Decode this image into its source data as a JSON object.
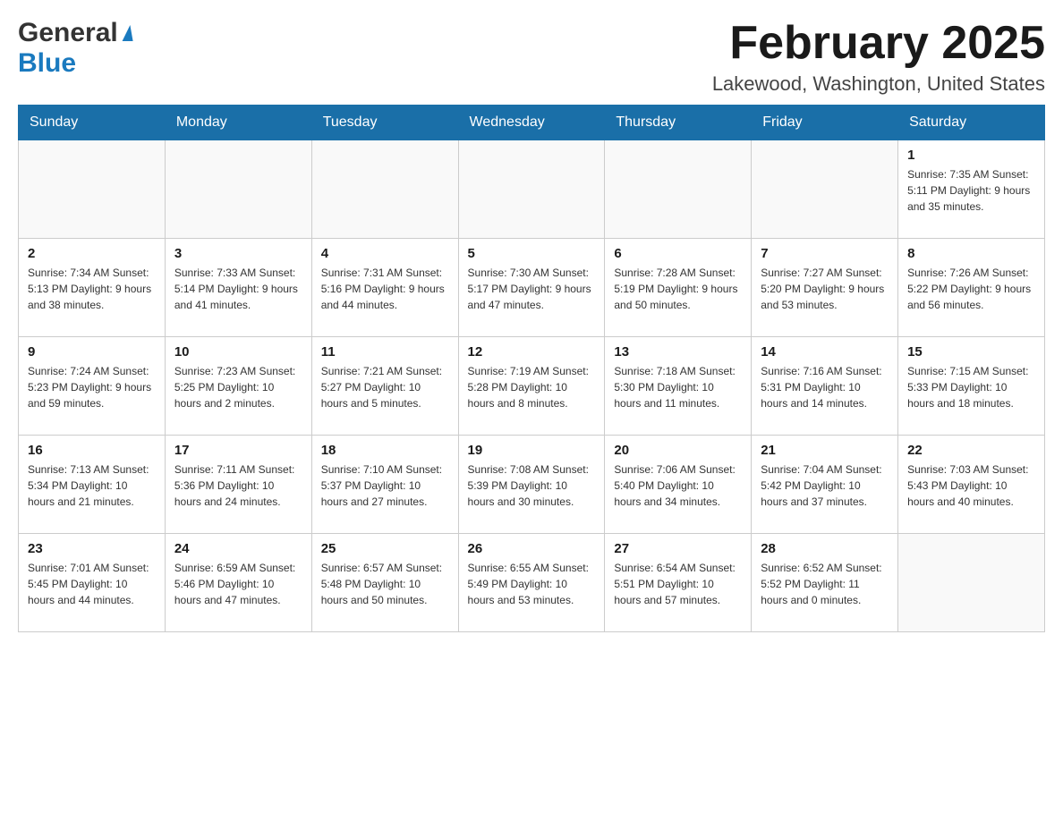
{
  "header": {
    "logo_general": "General",
    "logo_blue": "Blue",
    "month_title": "February 2025",
    "location": "Lakewood, Washington, United States"
  },
  "days_of_week": [
    "Sunday",
    "Monday",
    "Tuesday",
    "Wednesday",
    "Thursday",
    "Friday",
    "Saturday"
  ],
  "weeks": [
    {
      "days": [
        {
          "number": "",
          "info": ""
        },
        {
          "number": "",
          "info": ""
        },
        {
          "number": "",
          "info": ""
        },
        {
          "number": "",
          "info": ""
        },
        {
          "number": "",
          "info": ""
        },
        {
          "number": "",
          "info": ""
        },
        {
          "number": "1",
          "info": "Sunrise: 7:35 AM\nSunset: 5:11 PM\nDaylight: 9 hours and 35 minutes."
        }
      ]
    },
    {
      "days": [
        {
          "number": "2",
          "info": "Sunrise: 7:34 AM\nSunset: 5:13 PM\nDaylight: 9 hours and 38 minutes."
        },
        {
          "number": "3",
          "info": "Sunrise: 7:33 AM\nSunset: 5:14 PM\nDaylight: 9 hours and 41 minutes."
        },
        {
          "number": "4",
          "info": "Sunrise: 7:31 AM\nSunset: 5:16 PM\nDaylight: 9 hours and 44 minutes."
        },
        {
          "number": "5",
          "info": "Sunrise: 7:30 AM\nSunset: 5:17 PM\nDaylight: 9 hours and 47 minutes."
        },
        {
          "number": "6",
          "info": "Sunrise: 7:28 AM\nSunset: 5:19 PM\nDaylight: 9 hours and 50 minutes."
        },
        {
          "number": "7",
          "info": "Sunrise: 7:27 AM\nSunset: 5:20 PM\nDaylight: 9 hours and 53 minutes."
        },
        {
          "number": "8",
          "info": "Sunrise: 7:26 AM\nSunset: 5:22 PM\nDaylight: 9 hours and 56 minutes."
        }
      ]
    },
    {
      "days": [
        {
          "number": "9",
          "info": "Sunrise: 7:24 AM\nSunset: 5:23 PM\nDaylight: 9 hours and 59 minutes."
        },
        {
          "number": "10",
          "info": "Sunrise: 7:23 AM\nSunset: 5:25 PM\nDaylight: 10 hours and 2 minutes."
        },
        {
          "number": "11",
          "info": "Sunrise: 7:21 AM\nSunset: 5:27 PM\nDaylight: 10 hours and 5 minutes."
        },
        {
          "number": "12",
          "info": "Sunrise: 7:19 AM\nSunset: 5:28 PM\nDaylight: 10 hours and 8 minutes."
        },
        {
          "number": "13",
          "info": "Sunrise: 7:18 AM\nSunset: 5:30 PM\nDaylight: 10 hours and 11 minutes."
        },
        {
          "number": "14",
          "info": "Sunrise: 7:16 AM\nSunset: 5:31 PM\nDaylight: 10 hours and 14 minutes."
        },
        {
          "number": "15",
          "info": "Sunrise: 7:15 AM\nSunset: 5:33 PM\nDaylight: 10 hours and 18 minutes."
        }
      ]
    },
    {
      "days": [
        {
          "number": "16",
          "info": "Sunrise: 7:13 AM\nSunset: 5:34 PM\nDaylight: 10 hours and 21 minutes."
        },
        {
          "number": "17",
          "info": "Sunrise: 7:11 AM\nSunset: 5:36 PM\nDaylight: 10 hours and 24 minutes."
        },
        {
          "number": "18",
          "info": "Sunrise: 7:10 AM\nSunset: 5:37 PM\nDaylight: 10 hours and 27 minutes."
        },
        {
          "number": "19",
          "info": "Sunrise: 7:08 AM\nSunset: 5:39 PM\nDaylight: 10 hours and 30 minutes."
        },
        {
          "number": "20",
          "info": "Sunrise: 7:06 AM\nSunset: 5:40 PM\nDaylight: 10 hours and 34 minutes."
        },
        {
          "number": "21",
          "info": "Sunrise: 7:04 AM\nSunset: 5:42 PM\nDaylight: 10 hours and 37 minutes."
        },
        {
          "number": "22",
          "info": "Sunrise: 7:03 AM\nSunset: 5:43 PM\nDaylight: 10 hours and 40 minutes."
        }
      ]
    },
    {
      "days": [
        {
          "number": "23",
          "info": "Sunrise: 7:01 AM\nSunset: 5:45 PM\nDaylight: 10 hours and 44 minutes."
        },
        {
          "number": "24",
          "info": "Sunrise: 6:59 AM\nSunset: 5:46 PM\nDaylight: 10 hours and 47 minutes."
        },
        {
          "number": "25",
          "info": "Sunrise: 6:57 AM\nSunset: 5:48 PM\nDaylight: 10 hours and 50 minutes."
        },
        {
          "number": "26",
          "info": "Sunrise: 6:55 AM\nSunset: 5:49 PM\nDaylight: 10 hours and 53 minutes."
        },
        {
          "number": "27",
          "info": "Sunrise: 6:54 AM\nSunset: 5:51 PM\nDaylight: 10 hours and 57 minutes."
        },
        {
          "number": "28",
          "info": "Sunrise: 6:52 AM\nSunset: 5:52 PM\nDaylight: 11 hours and 0 minutes."
        },
        {
          "number": "",
          "info": ""
        }
      ]
    }
  ]
}
